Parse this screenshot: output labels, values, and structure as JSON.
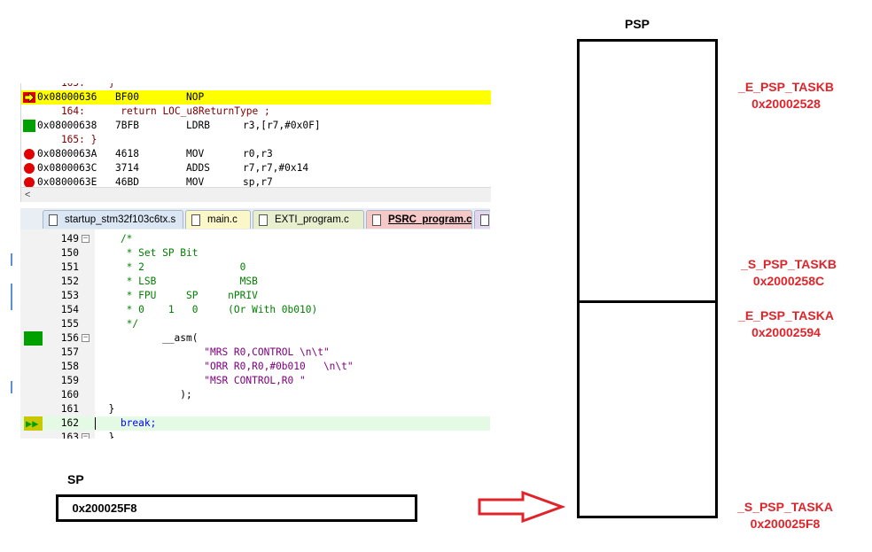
{
  "disassembly": {
    "lines": [
      {
        "kind": "src",
        "marker": "",
        "text": "    165:    }"
      },
      {
        "kind": "asm",
        "marker": "arrow",
        "addr": "0x08000636",
        "op": "BF00",
        "mn": "NOP",
        "args": ""
      },
      {
        "kind": "src",
        "marker": "",
        "text": "    164:      return LOC_u8ReturnType ;"
      },
      {
        "kind": "asm",
        "marker": "green",
        "addr": "0x08000638",
        "op": "7BFB",
        "mn": "LDRB",
        "args": "r3,[r7,#0x0F]"
      },
      {
        "kind": "src",
        "marker": "",
        "text": "    165: }"
      },
      {
        "kind": "asm",
        "marker": "red",
        "addr": "0x0800063A",
        "op": "4618",
        "mn": "MOV",
        "args": "r0,r3"
      },
      {
        "kind": "asm",
        "marker": "red",
        "addr": "0x0800063C",
        "op": "3714",
        "mn": "ADDS",
        "args": "r7,r7,#0x14"
      },
      {
        "kind": "asm",
        "marker": "red",
        "addr": "0x0800063E",
        "op": "46BD",
        "mn": "MOV",
        "args": "sp,r7"
      }
    ],
    "scroll_left": "<"
  },
  "tabs": [
    {
      "label": "startup_stm32f103c6tx.s",
      "color": "#dbe6f4",
      "active": false
    },
    {
      "label": "main.c",
      "color": "#fbf7c8",
      "active": false
    },
    {
      "label": "EXTI_program.c",
      "color": "#e7efcf",
      "active": false
    },
    {
      "label": "PSRC_program.c",
      "color": "#f6c9c9",
      "active": true
    },
    {
      "label": "",
      "color": "#e2d6ee",
      "active": false
    }
  ],
  "editor": {
    "lines": [
      {
        "n": "149",
        "fold": "-",
        "mark": "",
        "segs": [
          {
            "c": "k-com",
            "t": "    /*"
          }
        ]
      },
      {
        "n": "150",
        "fold": "|",
        "mark": "",
        "segs": [
          {
            "c": "k-com",
            "t": "     * Set SP Bit"
          }
        ]
      },
      {
        "n": "151",
        "fold": "|",
        "mark": "",
        "segs": [
          {
            "c": "k-com",
            "t": "     * 2                0"
          }
        ]
      },
      {
        "n": "152",
        "fold": "|",
        "mark": "",
        "segs": [
          {
            "c": "k-com",
            "t": "     * LSB              MSB"
          }
        ]
      },
      {
        "n": "153",
        "fold": "|",
        "mark": "",
        "segs": [
          {
            "c": "k-com",
            "t": "     * FPU     SP     nPRIV"
          }
        ]
      },
      {
        "n": "154",
        "fold": "|",
        "mark": "",
        "segs": [
          {
            "c": "k-com",
            "t": "     * 0    1   0     (Or With 0b010)"
          }
        ]
      },
      {
        "n": "155",
        "fold": "|",
        "mark": "",
        "segs": [
          {
            "c": "k-com",
            "t": "     */"
          }
        ]
      },
      {
        "n": "156",
        "fold": "-",
        "mark": "green",
        "segs": [
          {
            "c": "k-plain",
            "t": "           __asm("
          }
        ]
      },
      {
        "n": "157",
        "fold": "|",
        "mark": "",
        "segs": [
          {
            "c": "k-str",
            "t": "                  \"MRS R0,CONTROL \\n\\t\""
          }
        ]
      },
      {
        "n": "158",
        "fold": "|",
        "mark": "",
        "segs": [
          {
            "c": "k-str",
            "t": "                  \"ORR R0,R0,#0b010   \\n\\t\""
          }
        ]
      },
      {
        "n": "159",
        "fold": "|",
        "mark": "",
        "segs": [
          {
            "c": "k-str",
            "t": "                  \"MSR CONTROL,R0 \""
          }
        ]
      },
      {
        "n": "160",
        "fold": "|",
        "mark": "",
        "segs": [
          {
            "c": "k-plain",
            "t": "              );"
          }
        ]
      },
      {
        "n": "161",
        "fold": "|",
        "mark": "",
        "segs": [
          {
            "c": "k-plain",
            "t": "  }"
          }
        ]
      },
      {
        "n": "162",
        "fold": "|",
        "mark": "arrow",
        "segs": [
          {
            "c": "k-kw",
            "t": "    break;"
          }
        ]
      },
      {
        "n": "163",
        "fold": "-",
        "mark": "",
        "segs": [
          {
            "c": "k-plain",
            "t": "  }"
          }
        ]
      }
    ]
  },
  "sp": {
    "label": "SP",
    "value": "0x200025F8"
  },
  "psp": {
    "title": "PSP",
    "labels": [
      {
        "name": "_E_PSP_TASKB",
        "addr": "0x20002528"
      },
      {
        "name": "_S_PSP_TASKB",
        "addr": "0x2000258C"
      },
      {
        "name": "_E_PSP_TASKA",
        "addr": "0x20002594"
      },
      {
        "name": "_S_PSP_TASKA",
        "addr": "0x200025F8"
      }
    ],
    "label_color": "#e0242a"
  },
  "colors": {
    "highlight": "#ffff00",
    "breakpoint": "#e00000",
    "bookmark": "#00a000",
    "arrow_outline": "#e0242a"
  }
}
